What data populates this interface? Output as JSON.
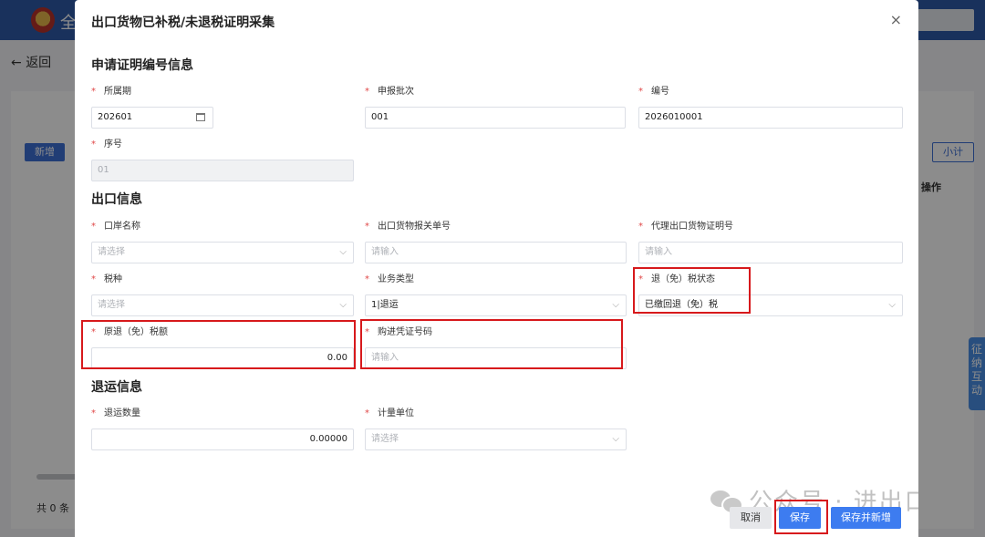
{
  "background": {
    "app_title": "全",
    "back_label": "返回",
    "new_button": "新增",
    "subtotal_button": "小计",
    "ops_header": "操作",
    "total_text": "共 0 条",
    "side_tab": "征纳互动"
  },
  "dialog": {
    "title": "出口货物已补税/未退税证明采集",
    "close_icon": "×",
    "sections": {
      "cert_info": "申请证明编号信息",
      "export_info": "出口信息",
      "return_info": "退运信息"
    },
    "fields": {
      "period": {
        "label": "所属期",
        "value": "202601"
      },
      "batch": {
        "label": "申报批次",
        "value": "001"
      },
      "number": {
        "label": "编号",
        "value": "2026010001"
      },
      "seq": {
        "label": "序号",
        "value": "01"
      },
      "port": {
        "label": "口岸名称",
        "placeholder": "请选择"
      },
      "customs_no": {
        "label": "出口货物报关单号",
        "placeholder": "请输入"
      },
      "agent_cert": {
        "label": "代理出口货物证明号",
        "placeholder": "请输入"
      },
      "tax_type": {
        "label": "税种",
        "placeholder": "请选择"
      },
      "biz_type": {
        "label": "业务类型",
        "value": "1|退运"
      },
      "refund_status": {
        "label": "退（免）税状态",
        "value": "已缴回退（免）税"
      },
      "orig_refund": {
        "label": "原退（免）税额",
        "value": "0.00"
      },
      "invoice_no": {
        "label": "购进凭证号码",
        "placeholder": "请输入"
      },
      "return_qty": {
        "label": "退运数量",
        "value": "0.00000"
      },
      "unit": {
        "label": "计量单位",
        "placeholder": "请选择"
      }
    },
    "buttons": {
      "cancel": "取消",
      "save": "保存",
      "save_new": "保存并新增"
    },
    "watermark": "公众号 · 进出口财税通"
  }
}
